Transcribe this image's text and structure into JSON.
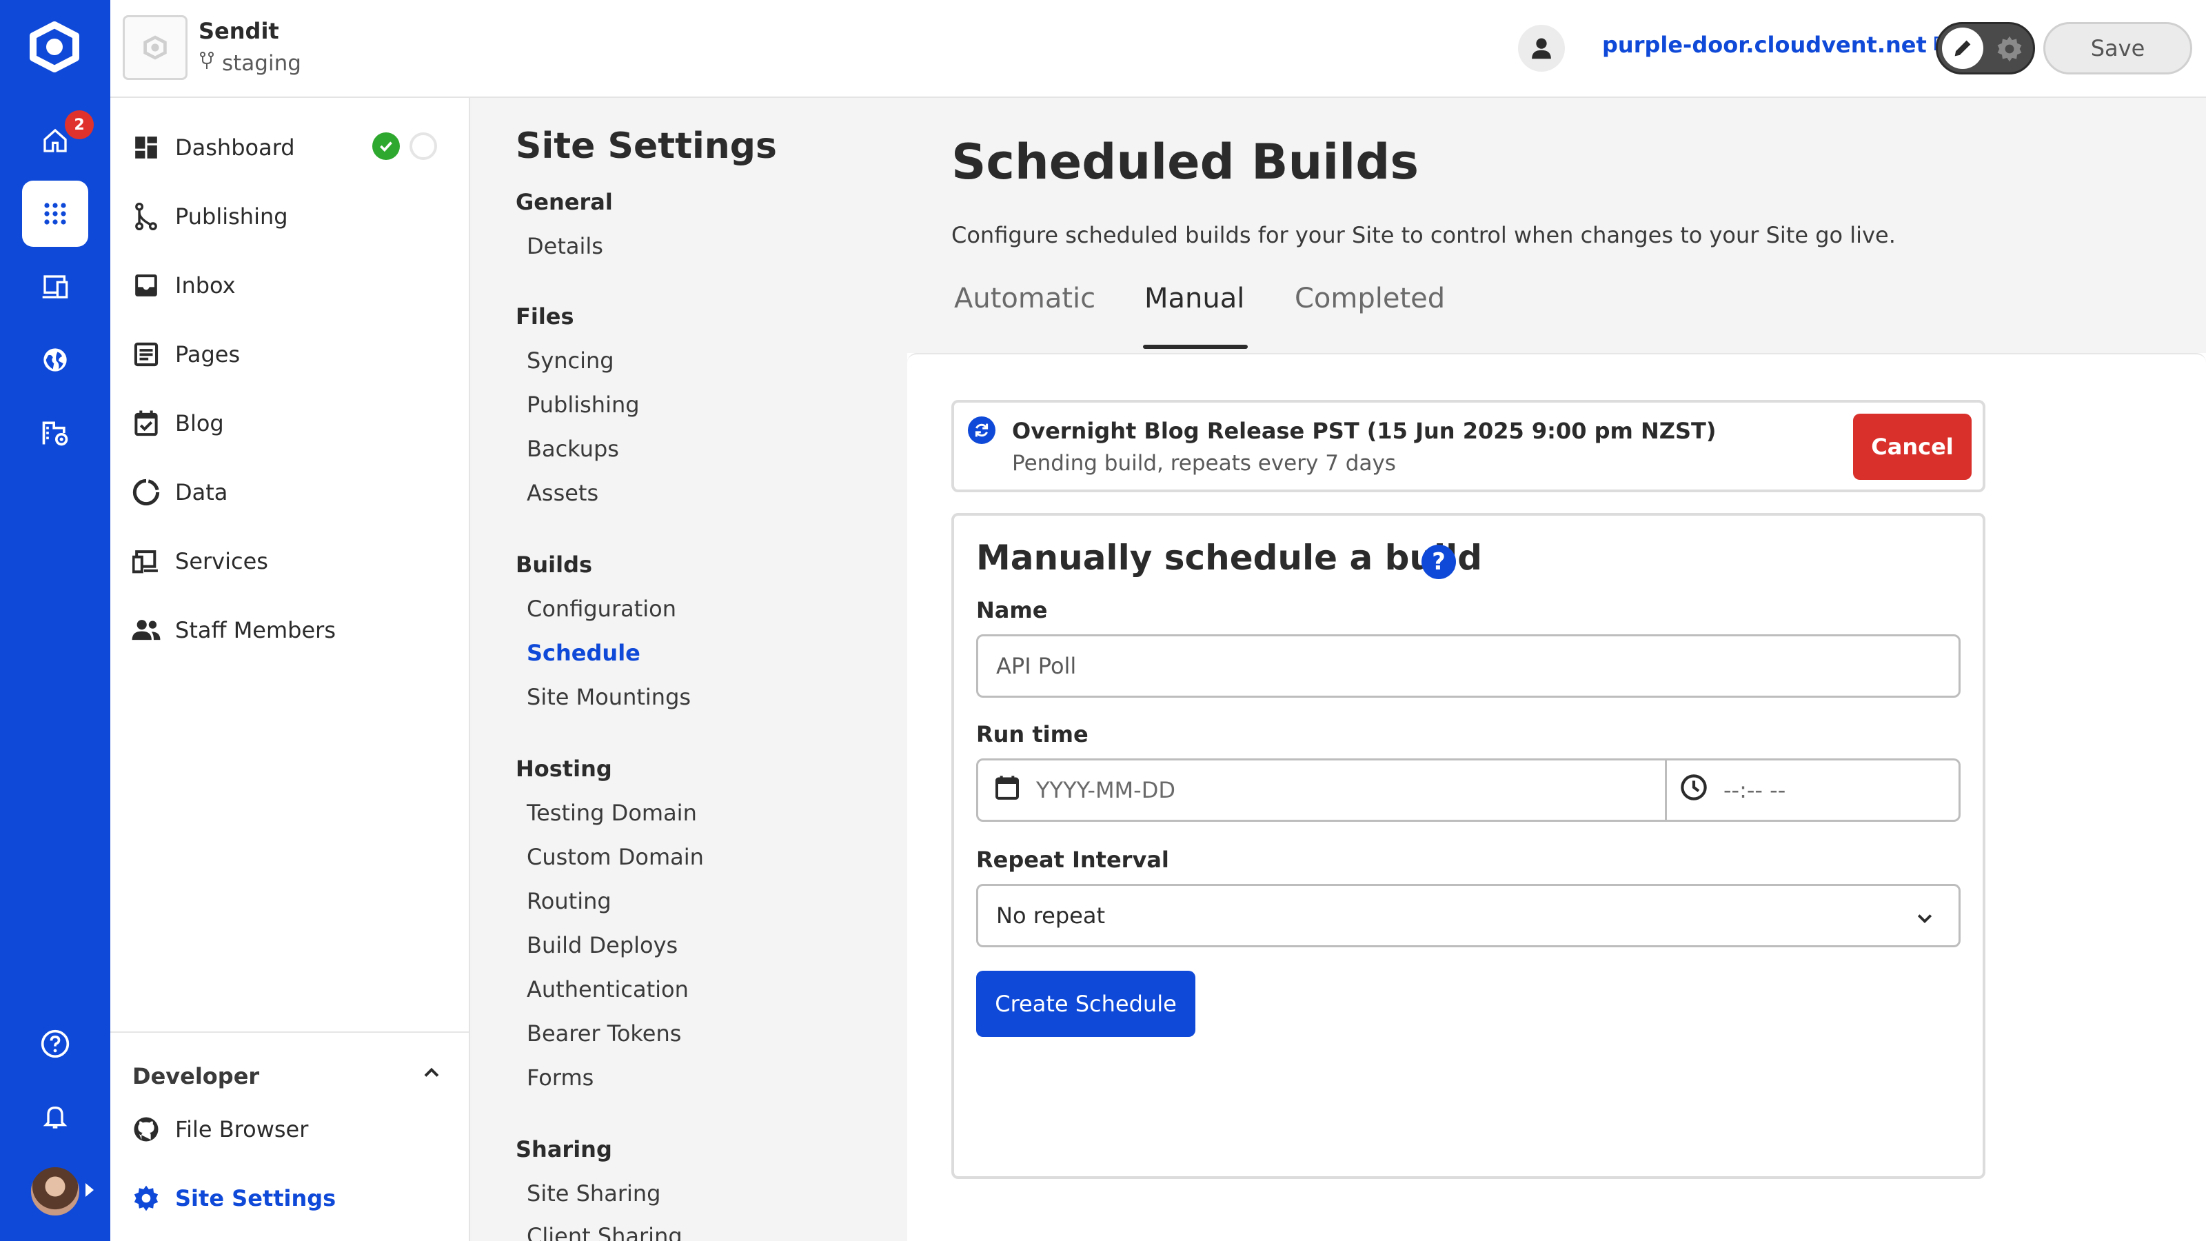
{
  "rail": {
    "badge_count": "2",
    "icons": [
      "home-icon",
      "apps-grid-icon",
      "devices-icon",
      "globe-icon",
      "domain-settings-icon",
      "help-icon",
      "bell-icon"
    ]
  },
  "topbar": {
    "site_name": "Sendit",
    "branch": "staging",
    "domain": "purple-door.cloudvent.net",
    "save_label": "Save"
  },
  "nav": {
    "items": [
      {
        "label": "Dashboard",
        "icon": "dashboard-icon"
      },
      {
        "label": "Publishing",
        "icon": "branch-icon"
      },
      {
        "label": "Inbox",
        "icon": "inbox-icon"
      },
      {
        "label": "Pages",
        "icon": "pages-icon"
      },
      {
        "label": "Blog",
        "icon": "calendar-check-icon"
      },
      {
        "label": "Data",
        "icon": "data-icon"
      },
      {
        "label": "Services",
        "icon": "services-icon"
      },
      {
        "label": "Staff Members",
        "icon": "people-icon"
      }
    ],
    "developer": {
      "heading": "Developer",
      "items": [
        {
          "label": "File Browser",
          "icon": "github-icon"
        },
        {
          "label": "Site Settings",
          "icon": "gear-icon"
        }
      ]
    }
  },
  "settings": {
    "title": "Site Settings",
    "groups": {
      "general": {
        "label": "General",
        "links": [
          "Details"
        ]
      },
      "files": {
        "label": "Files",
        "links": [
          "Syncing",
          "Publishing",
          "Backups",
          "Assets"
        ]
      },
      "builds": {
        "label": "Builds",
        "links": [
          "Configuration",
          "Schedule",
          "Site Mountings"
        ]
      },
      "hosting": {
        "label": "Hosting",
        "links": [
          "Testing Domain",
          "Custom Domain",
          "Routing",
          "Build Deploys",
          "Authentication",
          "Bearer Tokens",
          "Forms"
        ]
      },
      "sharing": {
        "label": "Sharing",
        "links": [
          "Site Sharing",
          "Client Sharing"
        ]
      }
    }
  },
  "main": {
    "title": "Scheduled Builds",
    "description": "Configure scheduled builds for your Site to control when changes to your Site go live.",
    "tabs": [
      "Automatic",
      "Manual",
      "Completed"
    ],
    "active_tab": "Manual",
    "scheduled": {
      "title": "Overnight Blog Release PST (15 Jun 2025 9:00 pm NZST)",
      "subtitle": "Pending build, repeats every 7 days",
      "cancel_label": "Cancel"
    },
    "form": {
      "title": "Manually schedule a build",
      "help": "?",
      "name_label": "Name",
      "name_value": "API Poll",
      "run_time_label": "Run time",
      "date_placeholder": "YYYY-MM-DD",
      "time_placeholder": "--:-- --",
      "repeat_label": "Repeat Interval",
      "repeat_value": "No repeat",
      "create_label": "Create Schedule"
    }
  },
  "colors": {
    "brand": "#0f49d8",
    "danger": "#d9302b",
    "success": "#2ea82e"
  }
}
